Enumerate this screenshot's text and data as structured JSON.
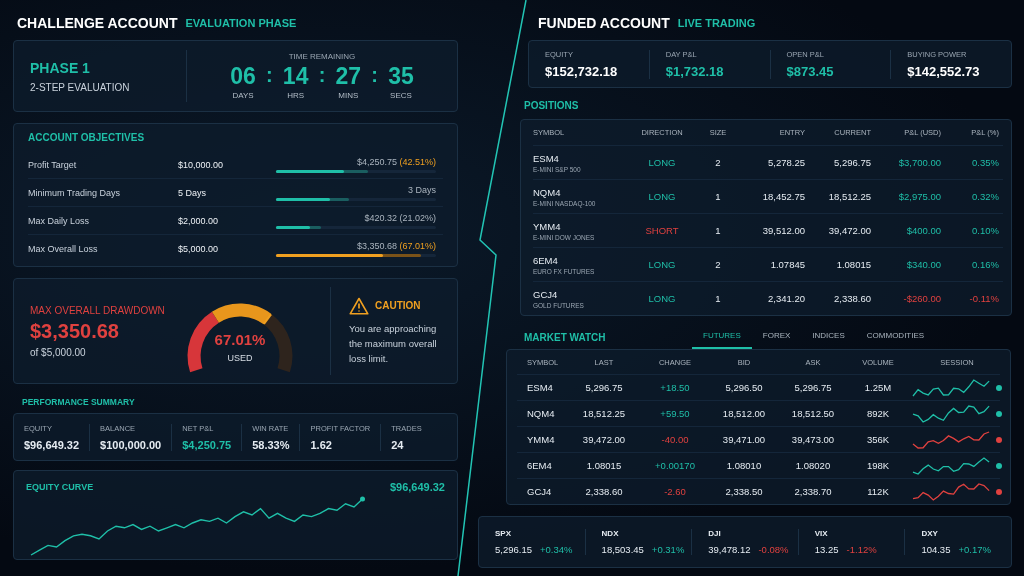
{
  "challenge": {
    "title": "CHALLENGE ACCOUNT",
    "subtitle": "EVALUATION PHASE",
    "phase": {
      "name": "PHASE 1",
      "type": "2-STEP EVALUATION"
    },
    "timer": {
      "label": "TIME REMAINING",
      "units": [
        {
          "value": "06",
          "label": "DAYS"
        },
        {
          "value": "14",
          "label": "HRS"
        },
        {
          "value": "27",
          "label": "MINS"
        },
        {
          "value": "35",
          "label": "SECS"
        }
      ],
      "separator": ":"
    },
    "objectives": {
      "title": "ACCOUNT OBJECTIVES",
      "rows": [
        {
          "name": "Profit Target",
          "limit": "$10,000.00",
          "progress": "$4,250.75",
          "percent": "(42.51%)",
          "percent_highlight": true,
          "level": 0.4251,
          "warning": false
        },
        {
          "name": "Minimum Trading Days",
          "limit": "5 Days",
          "progress": "3 Days",
          "level": 0.34,
          "warning": false
        },
        {
          "name": "Max Daily Loss",
          "limit": "$2,000.00",
          "progress": "$420.32",
          "percent": "(21.02%)",
          "percent_highlight": false,
          "level": 0.21,
          "warning": false
        },
        {
          "name": "Max Overall Loss",
          "limit": "$5,000.00",
          "progress": "$3,350.68",
          "percent": "(67.01%)",
          "percent_highlight": true,
          "level": 0.6701,
          "warning": true
        }
      ]
    },
    "drawdown": {
      "title": "MAX OVERALL DRAWDOWN",
      "amount": "$3,350.68",
      "of": "of $5,000.00",
      "gauge": {
        "value": "67.01%",
        "label": "USED"
      },
      "caution": {
        "title": "CAUTION",
        "text": "You are approaching the maximum overall loss limit."
      }
    },
    "performance": {
      "title": "PERFORMANCE SUMMARY",
      "stats": [
        {
          "label": "EQUITY",
          "value": "$96,649.32",
          "highlight": false
        },
        {
          "label": "BALANCE",
          "value": "$100,000.00",
          "highlight": false
        },
        {
          "label": "NET P&L",
          "value": "$4,250.75",
          "highlight": true
        },
        {
          "label": "WIN RATE",
          "value": "58.33%",
          "highlight": false
        },
        {
          "label": "PROFIT FACTOR",
          "value": "1.62",
          "highlight": false
        },
        {
          "label": "TRADES",
          "value": "24",
          "highlight": false
        }
      ]
    },
    "equity_curve": {
      "title": "EQUITY CURVE",
      "value": "$96,649.32"
    }
  },
  "funded": {
    "title": "FUNDED ACCOUNT",
    "subtitle": "LIVE TRADING",
    "metrics": [
      {
        "label": "EQUITY",
        "value": "$152,732.18",
        "highlight": false
      },
      {
        "label": "DAY P&L",
        "value": "$1,732.18",
        "highlight": true
      },
      {
        "label": "OPEN P&L",
        "value": "$873.45",
        "highlight": true
      },
      {
        "label": "BUYING POWER",
        "value": "$142,552.73",
        "highlight": false
      }
    ],
    "positions": {
      "title": "POSITIONS",
      "columns": [
        "SYMBOL",
        "DIRECTION",
        "SIZE",
        "ENTRY",
        "CURRENT",
        "P&L (USD)",
        "P&L (%)"
      ],
      "rows": [
        {
          "symbol": "ESM4",
          "description": "E-MINI S&P 500",
          "direction": "LONG",
          "short": false,
          "size": "2",
          "entry": "5,278.25",
          "current": "5,296.75",
          "pnl": "$3,700.00",
          "pnl_pct": "0.35%",
          "loss": false
        },
        {
          "symbol": "NQM4",
          "description": "E-MINI NASDAQ-100",
          "direction": "LONG",
          "short": false,
          "size": "1",
          "entry": "18,452.75",
          "current": "18,512.25",
          "pnl": "$2,975.00",
          "pnl_pct": "0.32%",
          "loss": false
        },
        {
          "symbol": "YMM4",
          "description": "E-MINI DOW JONES",
          "direction": "SHORT",
          "short": true,
          "size": "1",
          "entry": "39,512.00",
          "current": "39,472.00",
          "pnl": "$400.00",
          "pnl_pct": "0.10%",
          "loss": false
        },
        {
          "symbol": "6EM4",
          "description": "EURO FX FUTURES",
          "direction": "LONG",
          "short": false,
          "size": "2",
          "entry": "1.07845",
          "current": "1.08015",
          "pnl": "$340.00",
          "pnl_pct": "0.16%",
          "loss": false
        },
        {
          "symbol": "GCJ4",
          "description": "GOLD FUTURES",
          "direction": "LONG",
          "short": false,
          "size": "1",
          "entry": "2,341.20",
          "current": "2,338.60",
          "pnl": "-$260.00",
          "pnl_pct": "-0.11%",
          "loss": true
        }
      ]
    },
    "market_watch": {
      "title": "MARKET WATCH",
      "tabs": [
        {
          "label": "FUTURES",
          "selected": true
        },
        {
          "label": "FOREX",
          "selected": false
        },
        {
          "label": "INDICES",
          "selected": false
        },
        {
          "label": "COMMODITIES",
          "selected": false
        }
      ],
      "columns": [
        "SYMBOL",
        "LAST",
        "CHANGE",
        "BID",
        "ASK",
        "VOLUME",
        "SESSION"
      ],
      "rows": [
        {
          "symbol": "ESM4",
          "last": "5,296.75",
          "change": "+18.50",
          "bid": "5,296.50",
          "ask": "5,296.75",
          "volume": "1.25M",
          "loss": false,
          "color": "#1fbfa8"
        },
        {
          "symbol": "NQM4",
          "last": "18,512.25",
          "change": "+59.50",
          "bid": "18,512.00",
          "ask": "18,512.50",
          "volume": "892K",
          "loss": false,
          "color": "#1fbfa8"
        },
        {
          "symbol": "YMM4",
          "last": "39,472.00",
          "change": "-40.00",
          "bid": "39,471.00",
          "ask": "39,473.00",
          "volume": "356K",
          "loss": true,
          "color": "#e0413f"
        },
        {
          "symbol": "6EM4",
          "last": "1.08015",
          "change": "+0.00170",
          "bid": "1.08010",
          "ask": "1.08020",
          "volume": "198K",
          "loss": false,
          "color": "#1fbfa8"
        },
        {
          "symbol": "GCJ4",
          "last": "2,338.60",
          "change": "-2.60",
          "bid": "2,338.50",
          "ask": "2,338.70",
          "volume": "112K",
          "loss": true,
          "color": "#e0413f"
        }
      ]
    },
    "indices": [
      {
        "symbol": "SPX",
        "value": "5,296.15",
        "change": "+0.34%",
        "loss": false
      },
      {
        "symbol": "NDX",
        "value": "18,503.45",
        "change": "+0.31%",
        "loss": false
      },
      {
        "symbol": "DJI",
        "value": "39,478.12",
        "change": "-0.08%",
        "loss": true
      },
      {
        "symbol": "VIX",
        "value": "13.25",
        "change": "-1.12%",
        "loss": true
      },
      {
        "symbol": "DXY",
        "value": "104.35",
        "change": "+0.17%",
        "loss": false
      }
    ]
  }
}
